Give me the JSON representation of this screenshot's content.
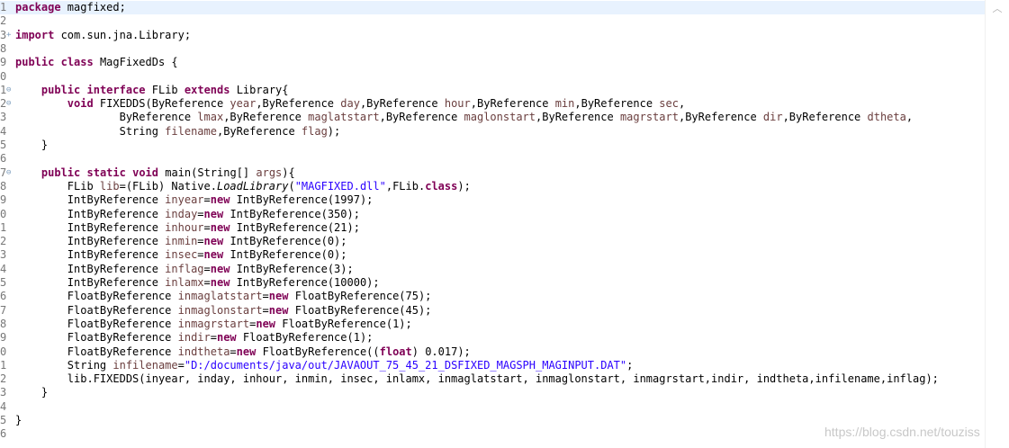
{
  "editor": {
    "lines": [
      {
        "num": "1",
        "fold": "",
        "code": [
          {
            "t": "package",
            "c": "kw"
          },
          {
            "t": " magfixed;"
          }
        ],
        "current": true
      },
      {
        "num": "2",
        "fold": "",
        "code": []
      },
      {
        "num": "3",
        "fold": "+",
        "code": [
          {
            "t": "import",
            "c": "kw"
          },
          {
            "t": " com.sun.jna.Library;"
          }
        ]
      },
      {
        "num": "8",
        "fold": "",
        "code": []
      },
      {
        "num": "9",
        "fold": "",
        "code": [
          {
            "t": "public",
            "c": "kw"
          },
          {
            "t": " "
          },
          {
            "t": "class",
            "c": "kw"
          },
          {
            "t": " MagFixedDs {"
          }
        ]
      },
      {
        "num": "0",
        "fold": "",
        "code": []
      },
      {
        "num": "1",
        "fold": "⊖",
        "code": [
          {
            "t": "    "
          },
          {
            "t": "public",
            "c": "kw"
          },
          {
            "t": " "
          },
          {
            "t": "interface",
            "c": "kw"
          },
          {
            "t": " FLib "
          },
          {
            "t": "extends",
            "c": "kw"
          },
          {
            "t": " Library{"
          }
        ]
      },
      {
        "num": "2",
        "fold": "⊖",
        "code": [
          {
            "t": "        "
          },
          {
            "t": "void",
            "c": "kw"
          },
          {
            "t": " FIXEDDS(ByReference "
          },
          {
            "t": "year",
            "c": "var"
          },
          {
            "t": ",ByReference "
          },
          {
            "t": "day",
            "c": "var"
          },
          {
            "t": ",ByReference "
          },
          {
            "t": "hour",
            "c": "var"
          },
          {
            "t": ",ByReference "
          },
          {
            "t": "min",
            "c": "var"
          },
          {
            "t": ",ByReference "
          },
          {
            "t": "sec",
            "c": "var"
          },
          {
            "t": ","
          }
        ]
      },
      {
        "num": "3",
        "fold": "",
        "code": [
          {
            "t": "                ByReference "
          },
          {
            "t": "lmax",
            "c": "var"
          },
          {
            "t": ",ByReference "
          },
          {
            "t": "maglatstart",
            "c": "var"
          },
          {
            "t": ",ByReference "
          },
          {
            "t": "maglonstart",
            "c": "var"
          },
          {
            "t": ",ByReference "
          },
          {
            "t": "magrstart",
            "c": "var"
          },
          {
            "t": ",ByReference "
          },
          {
            "t": "dir",
            "c": "var"
          },
          {
            "t": ",ByReference "
          },
          {
            "t": "dtheta",
            "c": "var"
          },
          {
            "t": ","
          }
        ]
      },
      {
        "num": "4",
        "fold": "",
        "code": [
          {
            "t": "                String "
          },
          {
            "t": "filename",
            "c": "var"
          },
          {
            "t": ",ByReference "
          },
          {
            "t": "flag",
            "c": "var"
          },
          {
            "t": ");"
          }
        ]
      },
      {
        "num": "5",
        "fold": "",
        "code": [
          {
            "t": "    }"
          }
        ]
      },
      {
        "num": "6",
        "fold": "",
        "code": []
      },
      {
        "num": "7",
        "fold": "⊖",
        "code": [
          {
            "t": "    "
          },
          {
            "t": "public",
            "c": "kw"
          },
          {
            "t": " "
          },
          {
            "t": "static",
            "c": "kw"
          },
          {
            "t": " "
          },
          {
            "t": "void",
            "c": "kw"
          },
          {
            "t": " main(String[] "
          },
          {
            "t": "args",
            "c": "var"
          },
          {
            "t": "){"
          }
        ]
      },
      {
        "num": "8",
        "fold": "",
        "code": [
          {
            "t": "        FLib "
          },
          {
            "t": "lib",
            "c": "var"
          },
          {
            "t": "=(FLib) Native."
          },
          {
            "t": "LoadLibrary",
            "c": "it"
          },
          {
            "t": "("
          },
          {
            "t": "\"MAGFIXED.dll\"",
            "c": "str"
          },
          {
            "t": ",FLib."
          },
          {
            "t": "class",
            "c": "kw"
          },
          {
            "t": ");"
          }
        ]
      },
      {
        "num": "9",
        "fold": "",
        "code": [
          {
            "t": "        IntByReference "
          },
          {
            "t": "inyear",
            "c": "var"
          },
          {
            "t": "="
          },
          {
            "t": "new",
            "c": "kw"
          },
          {
            "t": " IntByReference(1997);"
          }
        ]
      },
      {
        "num": "0",
        "fold": "",
        "code": [
          {
            "t": "        IntByReference "
          },
          {
            "t": "inday",
            "c": "var"
          },
          {
            "t": "="
          },
          {
            "t": "new",
            "c": "kw"
          },
          {
            "t": " IntByReference(350);"
          }
        ]
      },
      {
        "num": "1",
        "fold": "",
        "code": [
          {
            "t": "        IntByReference "
          },
          {
            "t": "inhour",
            "c": "var"
          },
          {
            "t": "="
          },
          {
            "t": "new",
            "c": "kw"
          },
          {
            "t": " IntByReference(21);"
          }
        ]
      },
      {
        "num": "2",
        "fold": "",
        "code": [
          {
            "t": "        IntByReference "
          },
          {
            "t": "inmin",
            "c": "var"
          },
          {
            "t": "="
          },
          {
            "t": "new",
            "c": "kw"
          },
          {
            "t": " IntByReference(0);"
          }
        ]
      },
      {
        "num": "3",
        "fold": "",
        "code": [
          {
            "t": "        IntByReference "
          },
          {
            "t": "insec",
            "c": "var"
          },
          {
            "t": "="
          },
          {
            "t": "new",
            "c": "kw"
          },
          {
            "t": " IntByReference(0);"
          }
        ]
      },
      {
        "num": "4",
        "fold": "",
        "code": [
          {
            "t": "        IntByReference "
          },
          {
            "t": "inflag",
            "c": "var"
          },
          {
            "t": "="
          },
          {
            "t": "new",
            "c": "kw"
          },
          {
            "t": " IntByReference(3);"
          }
        ]
      },
      {
        "num": "5",
        "fold": "",
        "code": [
          {
            "t": "        IntByReference "
          },
          {
            "t": "inlamx",
            "c": "var"
          },
          {
            "t": "="
          },
          {
            "t": "new",
            "c": "kw"
          },
          {
            "t": " IntByReference(10000);"
          }
        ]
      },
      {
        "num": "6",
        "fold": "",
        "code": [
          {
            "t": "        FloatByReference "
          },
          {
            "t": "inmaglatstart",
            "c": "var"
          },
          {
            "t": "="
          },
          {
            "t": "new",
            "c": "kw"
          },
          {
            "t": " FloatByReference(75);"
          }
        ]
      },
      {
        "num": "7",
        "fold": "",
        "code": [
          {
            "t": "        FloatByReference "
          },
          {
            "t": "inmaglonstart",
            "c": "var"
          },
          {
            "t": "="
          },
          {
            "t": "new",
            "c": "kw"
          },
          {
            "t": " FloatByReference(45);"
          }
        ]
      },
      {
        "num": "8",
        "fold": "",
        "code": [
          {
            "t": "        FloatByReference "
          },
          {
            "t": "inmagrstart",
            "c": "var"
          },
          {
            "t": "="
          },
          {
            "t": "new",
            "c": "kw"
          },
          {
            "t": " FloatByReference(1);"
          }
        ]
      },
      {
        "num": "9",
        "fold": "",
        "code": [
          {
            "t": "        FloatByReference "
          },
          {
            "t": "indir",
            "c": "var"
          },
          {
            "t": "="
          },
          {
            "t": "new",
            "c": "kw"
          },
          {
            "t": " FloatByReference(1);"
          }
        ]
      },
      {
        "num": "0",
        "fold": "",
        "code": [
          {
            "t": "        FloatByReference "
          },
          {
            "t": "indtheta",
            "c": "var"
          },
          {
            "t": "="
          },
          {
            "t": "new",
            "c": "kw"
          },
          {
            "t": " FloatByReference(("
          },
          {
            "t": "float",
            "c": "kw"
          },
          {
            "t": ") 0.017);"
          }
        ]
      },
      {
        "num": "1",
        "fold": "",
        "code": [
          {
            "t": "        String "
          },
          {
            "t": "infilename",
            "c": "var"
          },
          {
            "t": "="
          },
          {
            "t": "\"D:/documents/java/out/JAVAOUT_75_45_21_DSFIXED_MAGSPH_MAGINPUT.DAT\"",
            "c": "str"
          },
          {
            "t": ";"
          }
        ]
      },
      {
        "num": "2",
        "fold": "",
        "code": [
          {
            "t": "        lib.FIXEDDS(inyear, inday, inhour, inmin, insec, inlamx, inmaglatstart, inmaglonstart, inmagrstart,indir, indtheta,infilename,inflag);"
          }
        ]
      },
      {
        "num": "3",
        "fold": "",
        "code": [
          {
            "t": "    }"
          }
        ]
      },
      {
        "num": "4",
        "fold": "",
        "code": []
      },
      {
        "num": "5",
        "fold": "",
        "code": [
          {
            "t": "}"
          }
        ]
      },
      {
        "num": "6",
        "fold": "",
        "code": []
      }
    ]
  },
  "scrollbar": {
    "up_icon": "chevron-up-icon",
    "up_glyph": "︿"
  },
  "watermark": "https://blog.csdn.net/touziss",
  "colors": {
    "keyword": "#7f0055",
    "string": "#2a00ff",
    "variable": "#6a3e3e",
    "line_number": "#787878",
    "current_line": "#e8f2fe"
  }
}
